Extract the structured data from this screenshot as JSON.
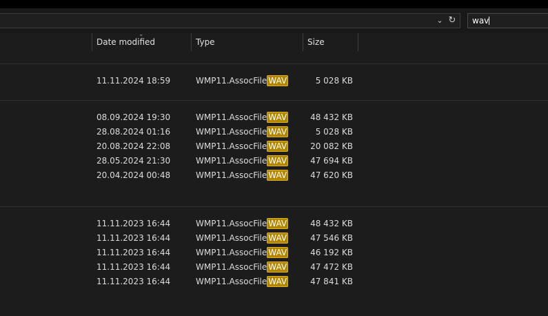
{
  "search": {
    "value": "wav"
  },
  "columns": {
    "date_modified": "Date modified",
    "type": "Type",
    "size": "Size"
  },
  "files": [
    {
      "date": "11.11.2024 18:59",
      "type_prefix": "WMP11.AssocFile",
      "type_match": "WAV",
      "size": "5 028 KB"
    },
    {
      "date": "08.09.2024 19:30",
      "type_prefix": "WMP11.AssocFile",
      "type_match": "WAV",
      "size": "48 432 KB"
    },
    {
      "date": "28.08.2024 01:16",
      "type_prefix": "WMP11.AssocFile",
      "type_match": "WAV",
      "size": "5 028 KB"
    },
    {
      "date": "20.08.2024 22:08",
      "type_prefix": "WMP11.AssocFile",
      "type_match": "WAV",
      "size": "20 082 KB"
    },
    {
      "date": "28.05.2024 21:30",
      "type_prefix": "WMP11.AssocFile",
      "type_match": "WAV",
      "size": "47 694 KB"
    },
    {
      "date": "20.04.2024 00:48",
      "type_prefix": "WMP11.AssocFile",
      "type_match": "WAV",
      "size": "47 620 KB"
    },
    {
      "date": "11.11.2023 16:44",
      "type_prefix": "WMP11.AssocFile",
      "type_match": "WAV",
      "size": "48 432 KB"
    },
    {
      "date": "11.11.2023 16:44",
      "type_prefix": "WMP11.AssocFile",
      "type_match": "WAV",
      "size": "47 546 KB"
    },
    {
      "date": "11.11.2023 16:44",
      "type_prefix": "WMP11.AssocFile",
      "type_match": "WAV",
      "size": "46 192 KB"
    },
    {
      "date": "11.11.2023 16:44",
      "type_prefix": "WMP11.AssocFile",
      "type_match": "WAV",
      "size": "47 472 KB"
    },
    {
      "date": "11.11.2023 16:44",
      "type_prefix": "WMP11.AssocFile",
      "type_match": "WAV",
      "size": "47 841 KB"
    }
  ],
  "icons": {
    "address_dropdown": "chevron-down-icon",
    "address_refresh": "refresh-icon",
    "sort": "sort-descending-icon"
  },
  "colors": {
    "background": "#1c1c1c",
    "highlight": "#b38600"
  }
}
